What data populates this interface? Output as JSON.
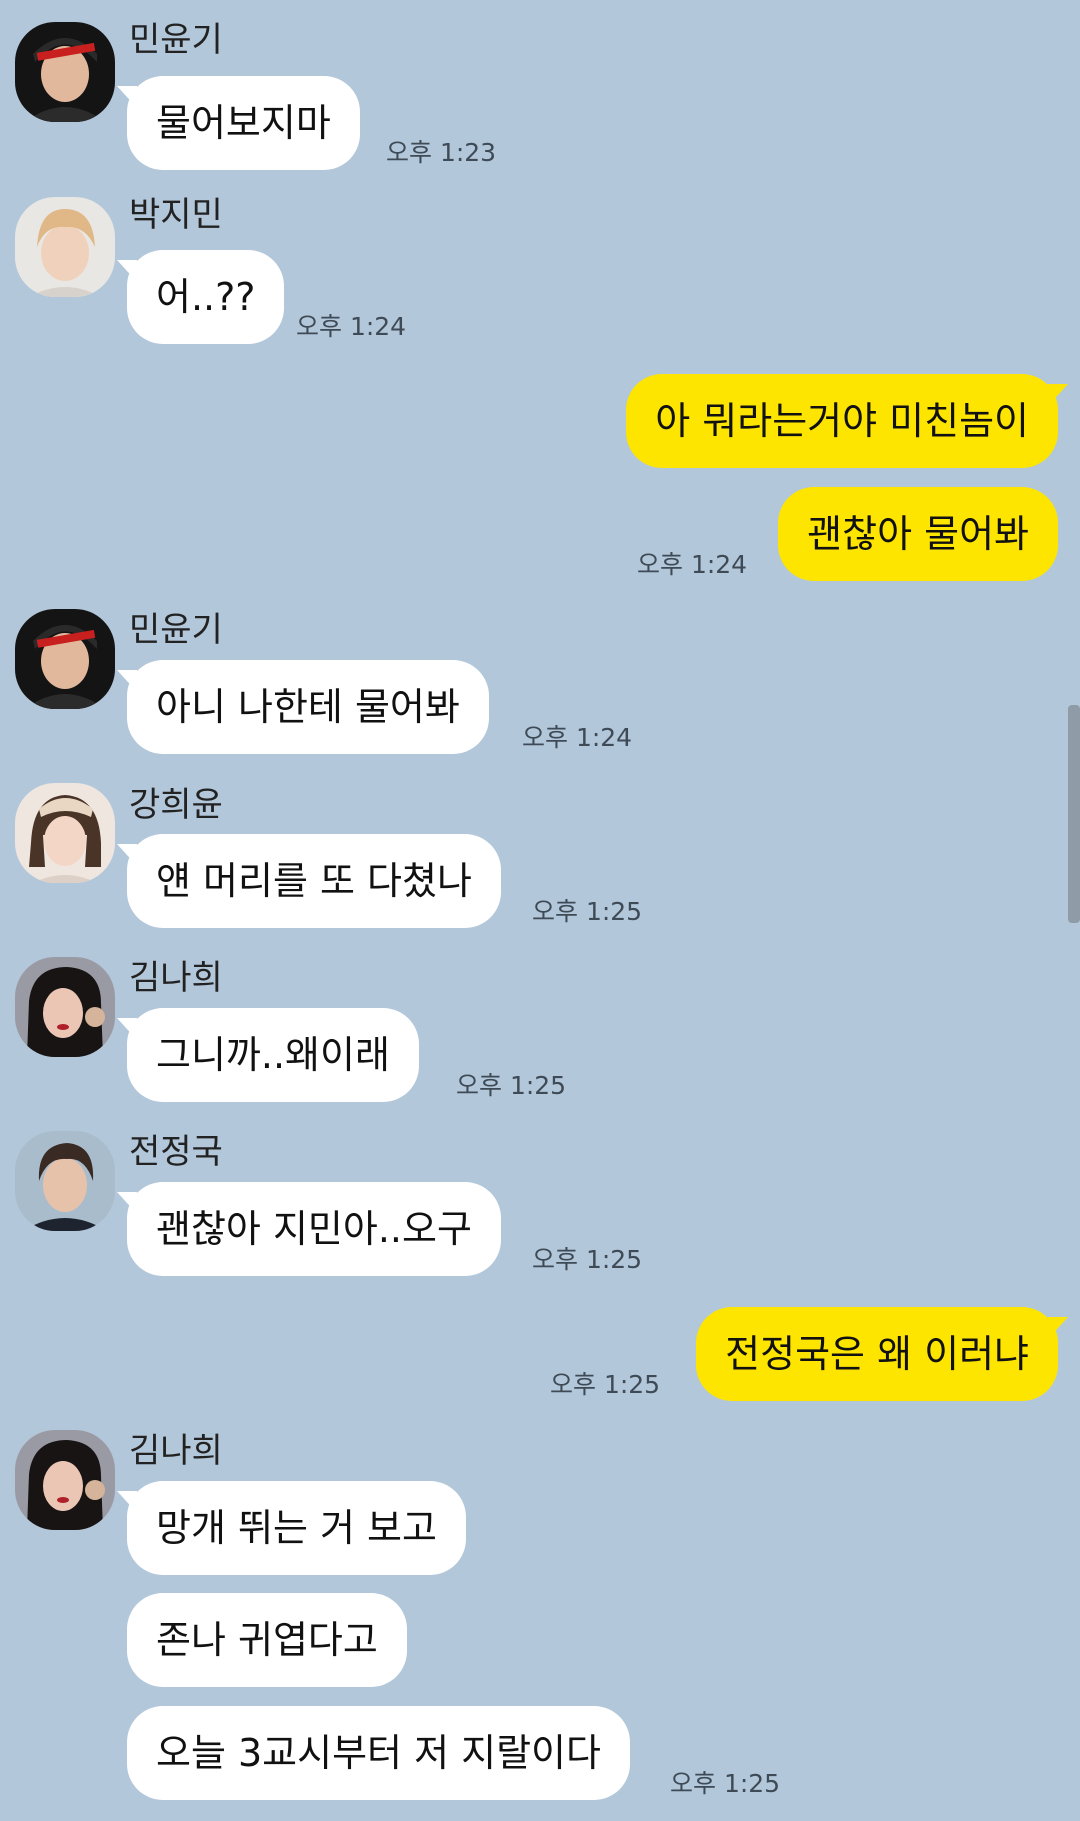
{
  "messages": [
    {
      "sender": "민윤기",
      "text": "물어보지마",
      "time": "오후 1:23"
    },
    {
      "sender": "박지민",
      "text": "어..??",
      "time": "오후 1:24"
    },
    {
      "text": "아 뭐라는거야 미친놈이"
    },
    {
      "text": "괜찮아 물어봐",
      "time": "오후 1:24"
    },
    {
      "sender": "민윤기",
      "text": "아니 나한테 물어봐",
      "time": "오후 1:24"
    },
    {
      "sender": "강희윤",
      "text": "얜 머리를 또 다쳤나",
      "time": "오후 1:25"
    },
    {
      "sender": "김나희",
      "text": "그니까..왜이래",
      "time": "오후 1:25"
    },
    {
      "sender": "전정국",
      "text": "괜찮아 지민아..오구",
      "time": "오후 1:25"
    },
    {
      "text": "전정국은 왜 이러냐",
      "time": "오후 1:25"
    },
    {
      "sender": "김나희",
      "text": "망개 뛰는 거 보고"
    },
    {
      "text": "존나 귀엽다고"
    },
    {
      "text": "오늘 3교시부터 저 지랄이다",
      "time": "오후 1:25"
    }
  ],
  "colors": {
    "background": "#b2c7da",
    "incoming_bubble": "#ffffff",
    "outgoing_bubble": "#fee500"
  }
}
